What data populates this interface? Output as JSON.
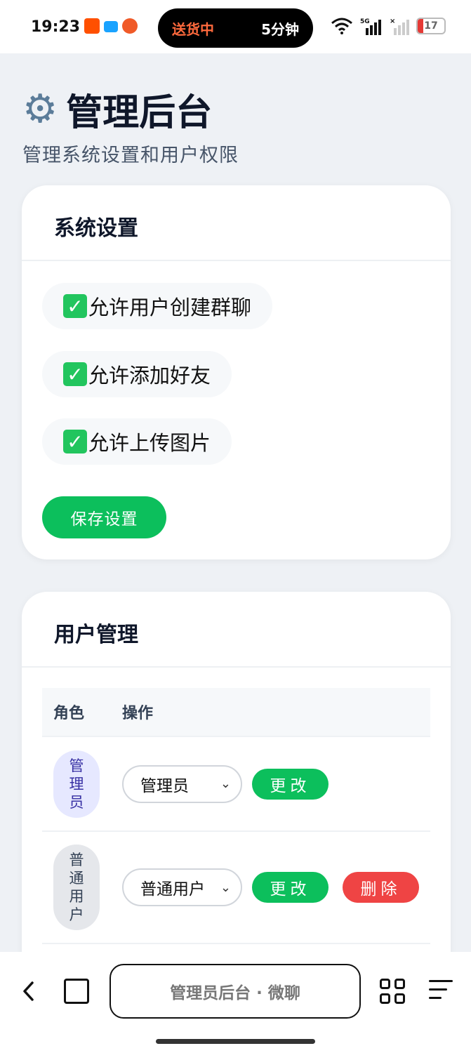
{
  "status_bar": {
    "time": "19:23",
    "island_left": "送货中",
    "island_right": "5分钟",
    "battery": "17"
  },
  "header": {
    "icon": "gear-icon",
    "title": "管理后台",
    "subtitle": "管理系统设置和用户权限"
  },
  "settings": {
    "title": "系统设置",
    "options": [
      {
        "label": "允许用户创建群聊",
        "checked": true
      },
      {
        "label": "允许添加好友",
        "checked": true
      },
      {
        "label": "允许上传图片",
        "checked": true
      }
    ],
    "save_label": "保存设置"
  },
  "users": {
    "title": "用户管理",
    "columns": [
      "角色",
      "操作"
    ],
    "rows": [
      {
        "role_badge": [
          "管",
          "理",
          "员"
        ],
        "role_select": "管理员",
        "change_label": "更改"
      },
      {
        "role_badge": [
          "普",
          "通",
          "用",
          "户"
        ],
        "role_select": "普通用户",
        "change_label": "更改",
        "delete_label": "删除"
      }
    ]
  },
  "browser": {
    "page_title": "管理员后台 · 微聊"
  },
  "colors": {
    "primary_green": "#0cbf5c",
    "danger_red": "#ef4444",
    "background": "#eef1f5"
  }
}
